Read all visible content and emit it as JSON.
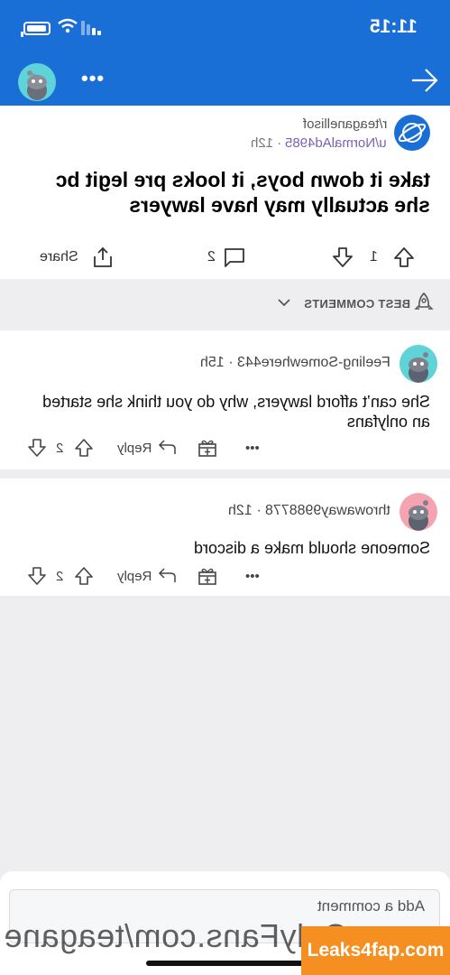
{
  "status_bar": {
    "time": "11:15"
  },
  "post": {
    "subreddit": "r/teaganellisof",
    "author": "u/NormalAd4985",
    "age": "12h",
    "title": "take it down boys, it looks pre legit bc she actually may have lawyers",
    "upvotes": "1",
    "comments": "2",
    "share_label": "Share"
  },
  "sort": {
    "label": "BEST COMMENTS"
  },
  "comments": [
    {
      "author": "Feeling-Somewhere443",
      "age": "15h",
      "body": "She can’t afford lawyers, why do you think she started an onlyfans",
      "votes": "2",
      "reply_label": "Reply",
      "avatar_color": "#5ed3d8"
    },
    {
      "author": "throwaway9988778",
      "age": "12h",
      "body": "Someone should make a discord",
      "votes": "2",
      "reply_label": "Reply",
      "avatar_color": "#f5a3b0"
    }
  ],
  "comment_input": {
    "placeholder": "Add a comment"
  },
  "watermark": {
    "text": "OnlyFans.com/teagane",
    "badge": "Leaks4fap.com"
  },
  "colors": {
    "header_blue": "#1a6fd6",
    "background": "#eeeef0",
    "watermark_orange": "#f58f22"
  }
}
